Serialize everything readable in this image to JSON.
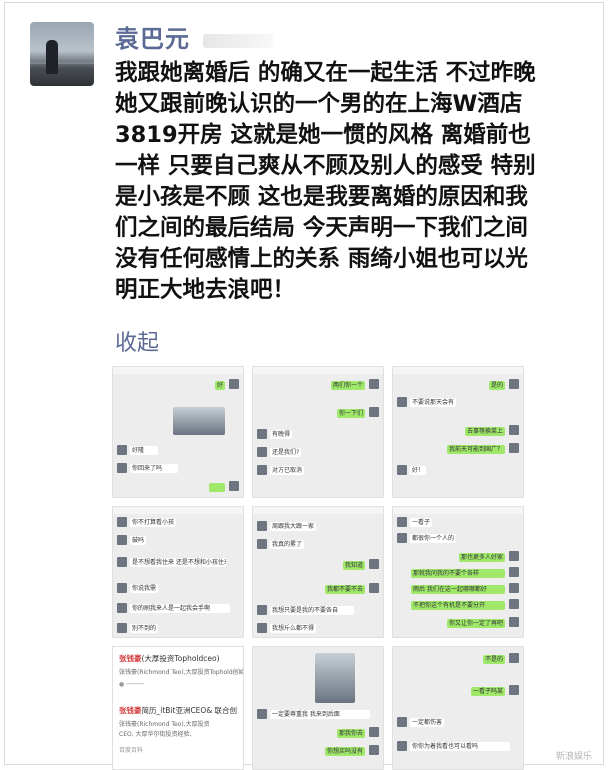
{
  "post": {
    "username": "袁巴元",
    "lines": [
      "我跟她离婚后 的确又在一起生活 不过昨晚",
      "她又跟前晚认识的一个男的在上海W酒店",
      "3819开房 这就是她一惯的风格 离婚前也",
      "一样 只要自己爽从不顾及别人的感受 特别",
      "是小孩是不顾 这也是我要离婚的原因和我",
      "们之间的最后结局 今天声明一下我们之间",
      "没有任何感情上的关系 雨绮小姐也可以光",
      "明正大地去浪吧！"
    ],
    "collapse_label": "收起"
  },
  "images": {
    "c1": {
      "b1": "好",
      "b2": "好隆",
      "b3": "你回来了吗",
      "b4": ""
    },
    "c2": {
      "b1": "两们你一个",
      "b2": "你一下们",
      "b3": "有晚得",
      "b4": "还是我们?",
      "b5": "对方已取消"
    },
    "c3": {
      "b1": "是的",
      "b2": "不要说那天会有",
      "b3": "去事等换菜上",
      "b4": "我前天可能到国广？",
      "b5": "好！"
    },
    "c4": {
      "b1": "你不打算看小孩",
      "b2": "鼓吗",
      "b3": "是不想看我住来 还是不想和小孩住来",
      "b4": "你说我需",
      "b5": "你的刷我来人是一起我会手啊",
      "b6": "别不到的"
    },
    "c5": {
      "b1": "周跟我大跟一家",
      "b2": "我真的累了",
      "b3": "我知道",
      "b4": "我都不要不去",
      "b5": "我想只要是我的不要各自",
      "b6": "我想斤么都不得"
    },
    "c6": {
      "b1": "一看子",
      "b2": "都很你一个人的",
      "b3": "那也更多人好家",
      "b4": "那就我问我的不要个各样",
      "b5": "雨后 我们在这一起哪哪都好",
      "b6": "不把你这个有机是不要分开",
      "b7": "你又让你一定了再吧"
    },
    "c7": {
      "name1": "张钱豪",
      "line1": "(大厚投资Topholdceo)",
      "line2": "张钱豪(Richmond Teo),大厚投资Tophold创始人",
      "name2": "张钱豪",
      "line3": "简历_itBit亚洲CEO& 联合创",
      "line4": "张钱豪(Richmond Teo),大厚投资",
      "line5": "CEO, 大厚华尔街投资经验,",
      "line6": "百度百科"
    },
    "c8": {
      "b1": "一定要尊重我 我来到后面",
      "b2": "那我你去",
      "b3": "你想买吗没有"
    },
    "c9": {
      "b1": "不是的",
      "b2": "一看子吗某",
      "b3": "一定都伤害",
      "b4": "你你为着我看也可以看吗"
    }
  },
  "watermark": "新浪娱乐"
}
